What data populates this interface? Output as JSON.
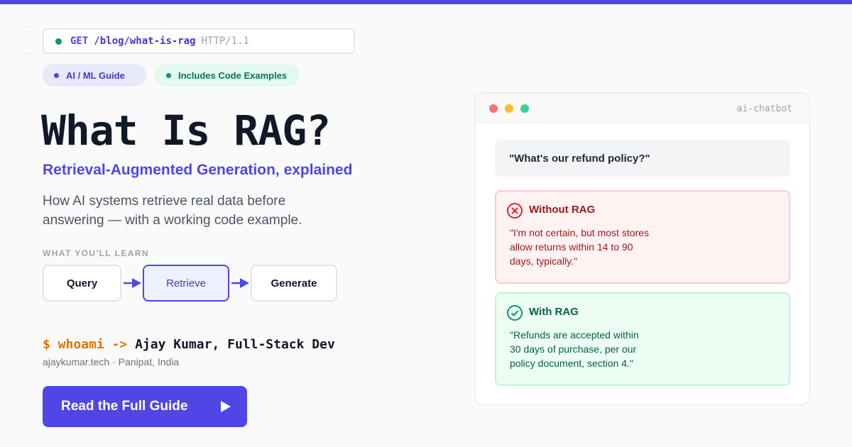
{
  "request": {
    "method": "GET",
    "path": "/blog/what-is-rag",
    "protocol": "HTTP/1.1"
  },
  "tags": [
    {
      "label": "AI / ML Guide"
    },
    {
      "label": "Includes Code Examples"
    }
  ],
  "hero": {
    "title": "What Is RAG?",
    "subtitle": "Retrieval-Augmented Generation, explained",
    "description": "How AI systems retrieve real data before answering — with a working code example."
  },
  "learn": {
    "label": "WHAT YOU'LL LEARN",
    "steps": [
      "Query",
      "Retrieve",
      "Generate"
    ]
  },
  "author": {
    "prompt": "$ whoami ->",
    "name": "Ajay Kumar, Full-Stack Dev",
    "site": "ajaykumar.tech · Panipat, India"
  },
  "cta": {
    "label": "Read the Full Guide"
  },
  "chat": {
    "window_title": "ai-chatbot",
    "question": "\"What's our refund policy?\"",
    "without": {
      "title": "Without RAG",
      "body": "\"I'm not certain, but most stores allow returns within 14 to 90 days, typically.\""
    },
    "with": {
      "title": "With RAG",
      "body": "\"Refunds are accepted within 30 days of purchase, per our policy document, section 4.\""
    }
  },
  "colors": {
    "accent": "#4f46e5",
    "success": "#059669",
    "warning": "#d97706",
    "error": "#dc2626"
  }
}
